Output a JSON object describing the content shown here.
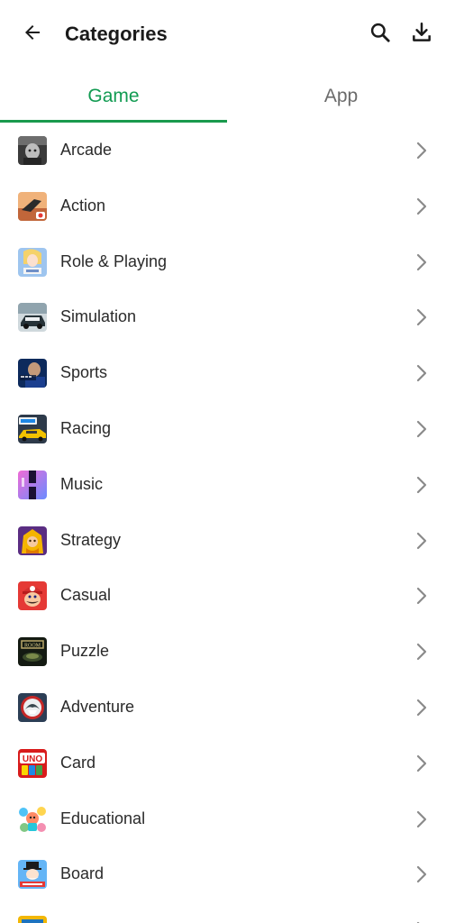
{
  "header": {
    "title": "Categories",
    "back_icon": "arrow-left-icon",
    "search_icon": "search-icon",
    "download_icon": "download-icon"
  },
  "tabs": [
    {
      "label": "Game",
      "active": true
    },
    {
      "label": "App",
      "active": false
    }
  ],
  "colors": {
    "accent": "#1a9a4d",
    "tab_inactive": "#6b6b6b",
    "chevron": "#8a8a8a"
  },
  "categories": [
    {
      "label": "Arcade",
      "icon": "arcade-game-icon"
    },
    {
      "label": "Action",
      "icon": "action-game-icon"
    },
    {
      "label": "Role & Playing",
      "icon": "role-playing-game-icon"
    },
    {
      "label": "Simulation",
      "icon": "simulation-game-icon"
    },
    {
      "label": "Sports",
      "icon": "sports-game-icon"
    },
    {
      "label": "Racing",
      "icon": "racing-game-icon"
    },
    {
      "label": "Music",
      "icon": "music-game-icon"
    },
    {
      "label": "Strategy",
      "icon": "strategy-game-icon"
    },
    {
      "label": "Casual",
      "icon": "casual-game-icon"
    },
    {
      "label": "Puzzle",
      "icon": "puzzle-game-icon"
    },
    {
      "label": "Adventure",
      "icon": "adventure-game-icon"
    },
    {
      "label": "Card",
      "icon": "card-game-icon"
    },
    {
      "label": "Educational",
      "icon": "educational-game-icon"
    },
    {
      "label": "Board",
      "icon": "board-game-icon"
    }
  ]
}
